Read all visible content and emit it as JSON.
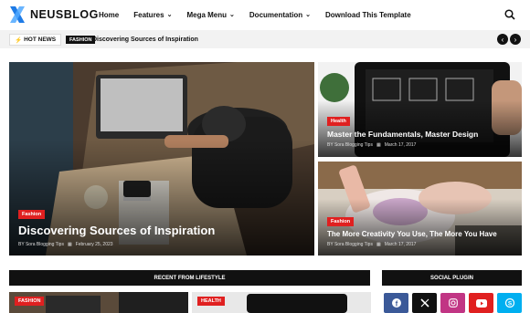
{
  "header": {
    "logo_text": "NEUSBLOG",
    "nav": [
      {
        "label": "Home",
        "dropdown": false
      },
      {
        "label": "Features",
        "dropdown": true
      },
      {
        "label": "Mega Menu",
        "dropdown": true
      },
      {
        "label": "Documentation",
        "dropdown": true
      },
      {
        "label": "Download This Template",
        "dropdown": false
      }
    ],
    "search_icon": "search-icon"
  },
  "ticker": {
    "label": "HOT NEWS",
    "tag": "FASHION",
    "title": "Discovering Sources of Inspiration",
    "prev_icon": "chevron-left-icon",
    "next_icon": "chevron-right-icon"
  },
  "featured": {
    "main": {
      "tag": "Fashion",
      "title": "Discovering Sources of Inspiration",
      "author": "BY Sora Blogging Tips",
      "date": "February 25, 2023"
    },
    "top": {
      "tag": "Health",
      "title": "Master the Fundamentals, Master Design",
      "author": "BY Sora Blogging Tips",
      "date": "March 17, 2017"
    },
    "bottom": {
      "tag": "Fashion",
      "title": "The More Creativity You Use, The More You Have",
      "author": "BY Sora Blogging Tips",
      "date": "March 17, 2017"
    }
  },
  "sections": {
    "recent_title": "RECENT FROM LIFESTYLE",
    "social_title": "SOCIAL PLUGIN",
    "recent_tags": [
      "FASHION",
      "HEALTH"
    ]
  },
  "social": [
    {
      "name": "facebook-icon",
      "color": "#3b5998"
    },
    {
      "name": "x-icon",
      "color": "#111111"
    },
    {
      "name": "instagram-icon",
      "color": "#c13584"
    },
    {
      "name": "youtube-icon",
      "color": "#e02020"
    },
    {
      "name": "skype-icon",
      "color": "#00aff0"
    }
  ],
  "colors": {
    "accent": "#e02020",
    "logo_blue": "#1e7be6",
    "dark": "#111111"
  }
}
